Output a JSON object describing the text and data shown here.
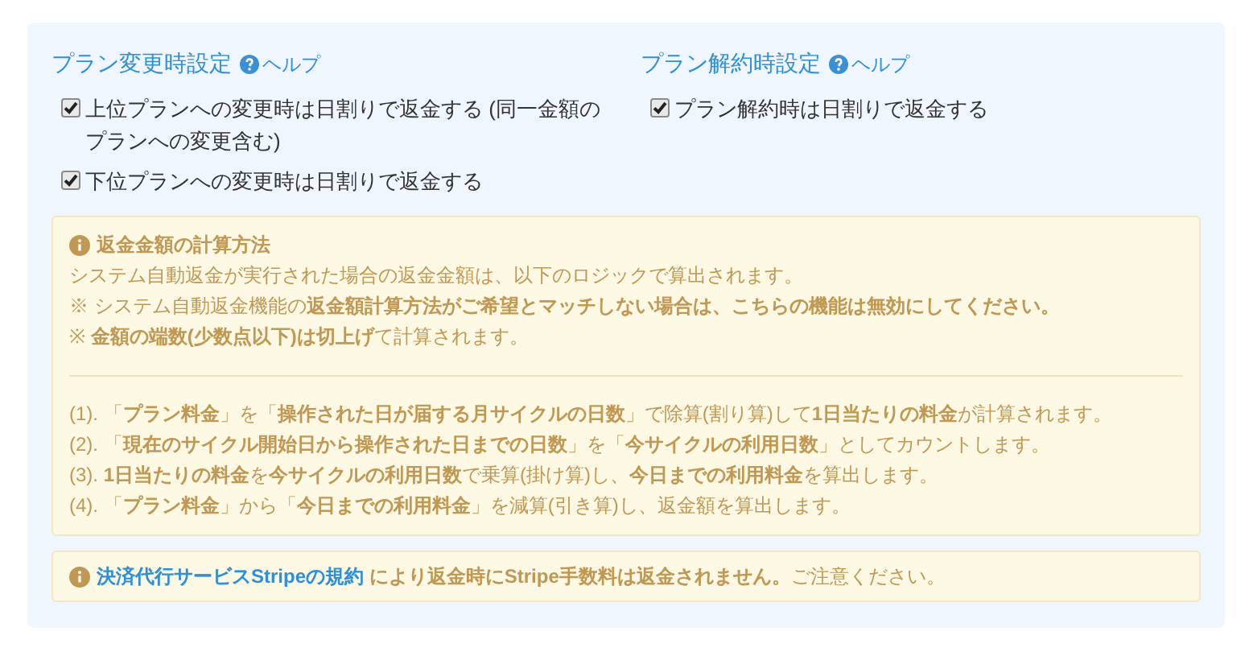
{
  "sections": [
    {
      "title": "プラン変更時設定",
      "help": "ヘルプ",
      "options": [
        {
          "label": "上位プランへの変更時は日割りで返金する (同一金額のプランへの変更含む)",
          "checked": true
        },
        {
          "label": "下位プランへの変更時は日割りで返金する",
          "checked": true
        }
      ]
    },
    {
      "title": "プラン解約時設定",
      "help": "ヘルプ",
      "options": [
        {
          "label": "プラン解約時は日割りで返金する",
          "checked": true
        }
      ]
    }
  ],
  "info": {
    "title": "返金金額の計算方法",
    "lines": [
      "システム自動返金が実行された場合の返金金額は、以下のロジックで算出されます。",
      "※ システム自動返金機能の**返金額計算方法がご希望とマッチしない場合は、こちらの機能は無効にしてください。**",
      "※ **金額の端数(少数点以下)は切上げ**て計算されます。"
    ],
    "steps": [
      "(1). 「**プラン料金**」を「**操作された日が届する月サイクルの日数**」で除算(割り算)して**1日当たりの料金**が計算されます。",
      "(2). 「**現在のサイクル開始日から操作された日までの日数**」を「**今サイクルの利用日数**」としてカウントします。",
      "(3). **1日当たりの料金**を**今サイクルの利用日数**で乗算(掛け算)し、**今日までの利用料金**を算出します。",
      "(4). 「**プラン料金**」から「**今日までの利用料金**」を減算(引き算)し、返金額を算出します。"
    ]
  },
  "notice": {
    "link": "決済代行サービスStripeの規約",
    "text": " **により返金時にStripe手数料は返金されません。**ご注意ください。"
  }
}
